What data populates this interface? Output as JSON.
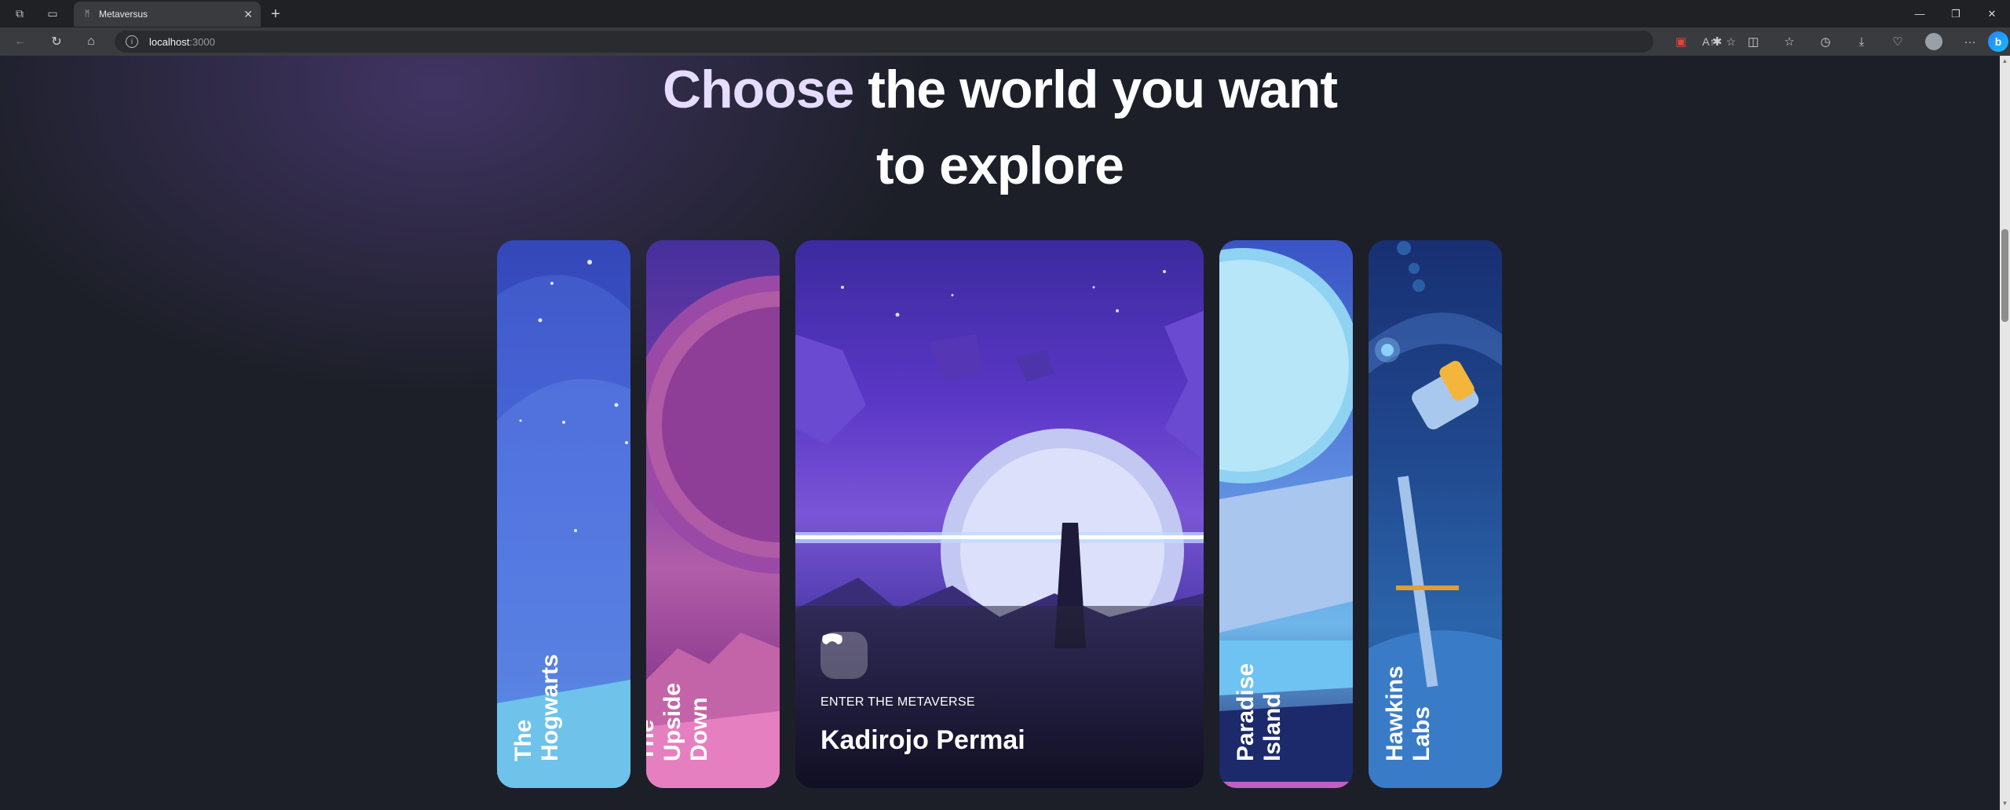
{
  "browser": {
    "tab_title": "Metaversus",
    "url_host": "localhost",
    "url_port": ":3000"
  },
  "hero": {
    "line1_accent": "Choose",
    "line1_rest": " the world you want",
    "line2": "to explore"
  },
  "worlds": [
    {
      "label": "The\nHogwarts",
      "active": false
    },
    {
      "label": "The Upside\nDown",
      "active": false
    },
    {
      "label": "Kadirojo Permai",
      "active": true,
      "cta": "ENTER THE METAVERSE"
    },
    {
      "label": "Paradise\nIsland",
      "active": false
    },
    {
      "label": "Hawkins\nLabs",
      "active": false
    }
  ],
  "icons": {
    "back": "back-arrow-icon",
    "reload": "reload-icon",
    "home": "home-icon",
    "vr_headset": "vr-headset-icon"
  }
}
